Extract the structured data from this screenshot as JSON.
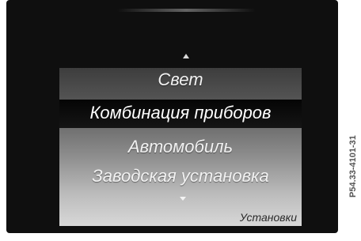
{
  "menu": {
    "items": [
      {
        "label": "Свет",
        "selected": false
      },
      {
        "label": "Комбинация приборов",
        "selected": true
      },
      {
        "label": "Автомобиль",
        "selected": false
      },
      {
        "label": "Заводская установка",
        "selected": false
      }
    ],
    "section_label": "Установки",
    "scroll_up_icon": "triangle-up",
    "scroll_down_icon": "triangle-down"
  },
  "figure_code": "P54.33-4101-31",
  "colors": {
    "bezel": "#0f0f0f",
    "selection": "#0a0a0a",
    "text": "#f2f2f2"
  }
}
